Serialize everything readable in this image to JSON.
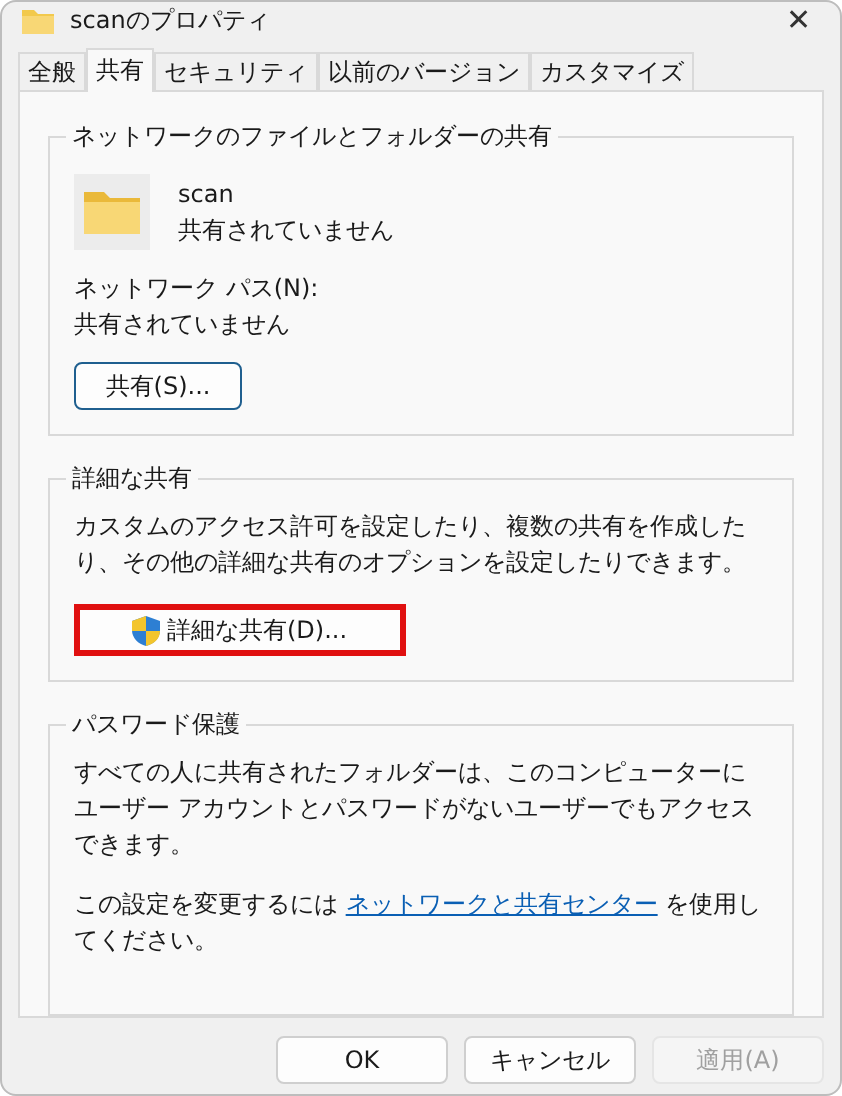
{
  "window": {
    "title": "scanのプロパティ",
    "close": "✕"
  },
  "tabs": [
    {
      "label": "全般",
      "selected": false
    },
    {
      "label": "共有",
      "selected": true
    },
    {
      "label": "セキュリティ",
      "selected": false
    },
    {
      "label": "以前のバージョン",
      "selected": false
    },
    {
      "label": "カスタマイズ",
      "selected": false
    }
  ],
  "network_sharing": {
    "legend": "ネットワークのファイルとフォルダーの共有",
    "folder_name": "scan",
    "folder_status": "共有されていません",
    "path_label": "ネットワーク パス(N):",
    "path_value": "共有されていません",
    "button": "共有(S)..."
  },
  "advanced_sharing": {
    "legend": "詳細な共有",
    "description": "カスタムのアクセス許可を設定したり、複数の共有を作成したり、その他の詳細な共有のオプションを設定したりできます。",
    "button": "詳細な共有(D)...",
    "highlighted": true
  },
  "password_protection": {
    "legend": "パスワード保護",
    "description": "すべての人に共有されたフォルダーは、このコンピューターにユーザー アカウントとパスワードがないユーザーでもアクセスできます。",
    "note_before": "この設定を変更するには ",
    "link": "ネットワークと共有センター",
    "note_after": " を使用してください。"
  },
  "buttons": [
    {
      "label": "OK",
      "disabled": false
    },
    {
      "label": "キャンセル",
      "disabled": false
    },
    {
      "label": "適用(A)",
      "disabled": true
    }
  ]
}
